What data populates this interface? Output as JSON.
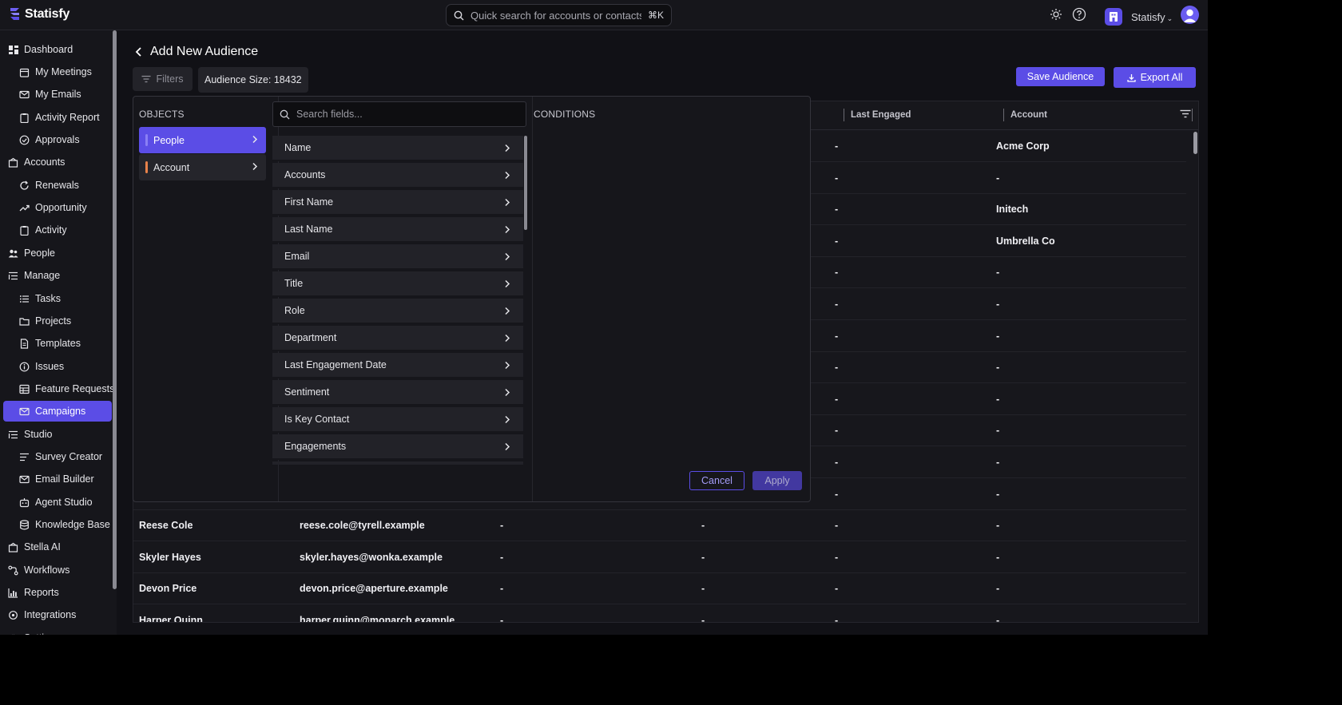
{
  "app": {
    "brand": "Statisfy",
    "search_placeholder": "Quick search for accounts or contacts",
    "search_shortcut": "⌘K",
    "org_name": "Statisfy"
  },
  "sidebar": {
    "items": [
      {
        "label": "Dashboard",
        "icon": "dashboard-icon",
        "level": "top"
      },
      {
        "label": "My Meetings",
        "icon": "calendar-icon",
        "level": "sub"
      },
      {
        "label": "My Emails",
        "icon": "mail-icon",
        "level": "sub"
      },
      {
        "label": "Activity Report",
        "icon": "clipboard-icon",
        "level": "sub"
      },
      {
        "label": "Approvals",
        "icon": "check-circle-icon",
        "level": "sub"
      },
      {
        "label": "Accounts",
        "icon": "building-icon",
        "level": "top"
      },
      {
        "label": "Renewals",
        "icon": "refresh-icon",
        "level": "sub"
      },
      {
        "label": "Opportunity",
        "icon": "trend-icon",
        "level": "sub"
      },
      {
        "label": "Activity",
        "icon": "clipboard-icon",
        "level": "sub"
      },
      {
        "label": "People",
        "icon": "people-icon",
        "level": "top"
      },
      {
        "label": "Manage",
        "icon": "list-icon",
        "level": "top"
      },
      {
        "label": "Tasks",
        "icon": "tasks-icon",
        "level": "sub"
      },
      {
        "label": "Projects",
        "icon": "folder-icon",
        "level": "sub"
      },
      {
        "label": "Templates",
        "icon": "document-icon",
        "level": "sub"
      },
      {
        "label": "Issues",
        "icon": "info-icon",
        "level": "sub"
      },
      {
        "label": "Feature Requests",
        "icon": "grid-icon",
        "level": "sub"
      },
      {
        "label": "Campaigns",
        "icon": "mail-icon",
        "level": "sub",
        "active": true
      },
      {
        "label": "Studio",
        "icon": "list-icon",
        "level": "top"
      },
      {
        "label": "Survey Creator",
        "icon": "lines-icon",
        "level": "sub"
      },
      {
        "label": "Email Builder",
        "icon": "mail-icon",
        "level": "sub"
      },
      {
        "label": "Agent Studio",
        "icon": "robot-icon",
        "level": "sub"
      },
      {
        "label": "Knowledge Base",
        "icon": "database-icon",
        "level": "sub"
      },
      {
        "label": "Stella AI",
        "icon": "building-icon",
        "level": "top"
      },
      {
        "label": "Workflows",
        "icon": "workflow-icon",
        "level": "top"
      },
      {
        "label": "Reports",
        "icon": "chart-icon",
        "level": "top"
      },
      {
        "label": "Integrations",
        "icon": "plug-icon",
        "level": "top"
      },
      {
        "label": "Settings",
        "icon": "gear-icon",
        "level": "top"
      }
    ]
  },
  "page": {
    "title": "Add New Audience",
    "filters_label": "Filters",
    "audience_size": "Audience Size: 18432",
    "save_label": "Save Audience",
    "export_label": "Export All"
  },
  "table": {
    "headers": {
      "last_engaged": "Last Engaged",
      "account": "Account"
    },
    "top_rows": [
      {
        "last_engaged": "-",
        "account": "Acme Corp"
      },
      {
        "last_engaged": "-",
        "account": "-"
      },
      {
        "last_engaged": "-",
        "account": "Initech"
      },
      {
        "last_engaged": "-",
        "account": "Umbrella Co"
      },
      {
        "last_engaged": "-",
        "account": "-"
      },
      {
        "last_engaged": "-",
        "account": "-"
      },
      {
        "last_engaged": "-",
        "account": "-"
      },
      {
        "last_engaged": "-",
        "account": "-"
      },
      {
        "last_engaged": "-",
        "account": "-"
      },
      {
        "last_engaged": "-",
        "account": "-"
      },
      {
        "last_engaged": "-",
        "account": "-"
      },
      {
        "last_engaged": "-",
        "account": "-"
      }
    ],
    "bottom_rows": [
      {
        "name": "Reese Cole",
        "email": "reese.cole@tyrell.example",
        "c3": "-",
        "c4": "-",
        "last_engaged": "-",
        "account": "-"
      },
      {
        "name": "Skyler Hayes",
        "email": "skyler.hayes@wonka.example",
        "c3": "-",
        "c4": "-",
        "last_engaged": "-",
        "account": "-"
      },
      {
        "name": "Devon Price",
        "email": "devon.price@aperture.example",
        "c3": "-",
        "c4": "-",
        "last_engaged": "-",
        "account": "-"
      },
      {
        "name": "Harper Quinn",
        "email": "harper.quinn@monarch.example",
        "c3": "-",
        "c4": "-",
        "last_engaged": "-",
        "account": "-"
      }
    ]
  },
  "filter_panel": {
    "objects_label": "OBJECTS",
    "objects": [
      {
        "label": "People",
        "active": true,
        "color": "#8a7ff5"
      },
      {
        "label": "Account",
        "active": false,
        "color": "#e8824a"
      }
    ],
    "field_search_placeholder": "Search fields...",
    "fields": [
      "Name",
      "Accounts",
      "First Name",
      "Last Name",
      "Email",
      "Title",
      "Role",
      "Department",
      "Last Engagement Date",
      "Sentiment",
      "Is Key Contact",
      "Engagements"
    ],
    "conditions_label": "CONDITIONS",
    "cancel_label": "Cancel",
    "apply_label": "Apply"
  },
  "colors": {
    "accent": "#5b4de6",
    "background": "#111116",
    "surface": "#16161b"
  }
}
